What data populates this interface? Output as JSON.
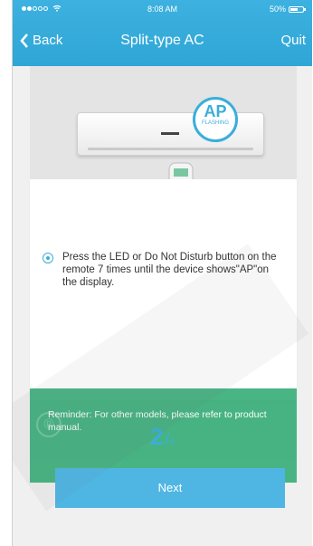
{
  "status_bar": {
    "time": "8:08 AM",
    "battery_percent": "50%",
    "battery_level": 0.5,
    "signal_bars_filled": 2,
    "signal_bars_total": 5
  },
  "nav": {
    "back_label": "Back",
    "title": "Split-type AC",
    "quit_label": "Quit"
  },
  "illustration": {
    "ap_label": "AP",
    "ap_sub": "FLASHING"
  },
  "card": {
    "instruction": "Press the LED or Do Not Disturb button on the remote 7 times until the device shows\"AP\"on the display.",
    "reminder": "Reminder: For other models, please refer to product manual."
  },
  "pager": {
    "current": "2",
    "separator": "/",
    "total": "4"
  },
  "actions": {
    "next_label": "Next"
  },
  "colors": {
    "accent": "#3aaedb",
    "header": "#2fa6d6",
    "reminder_bg": "#2aa970"
  }
}
